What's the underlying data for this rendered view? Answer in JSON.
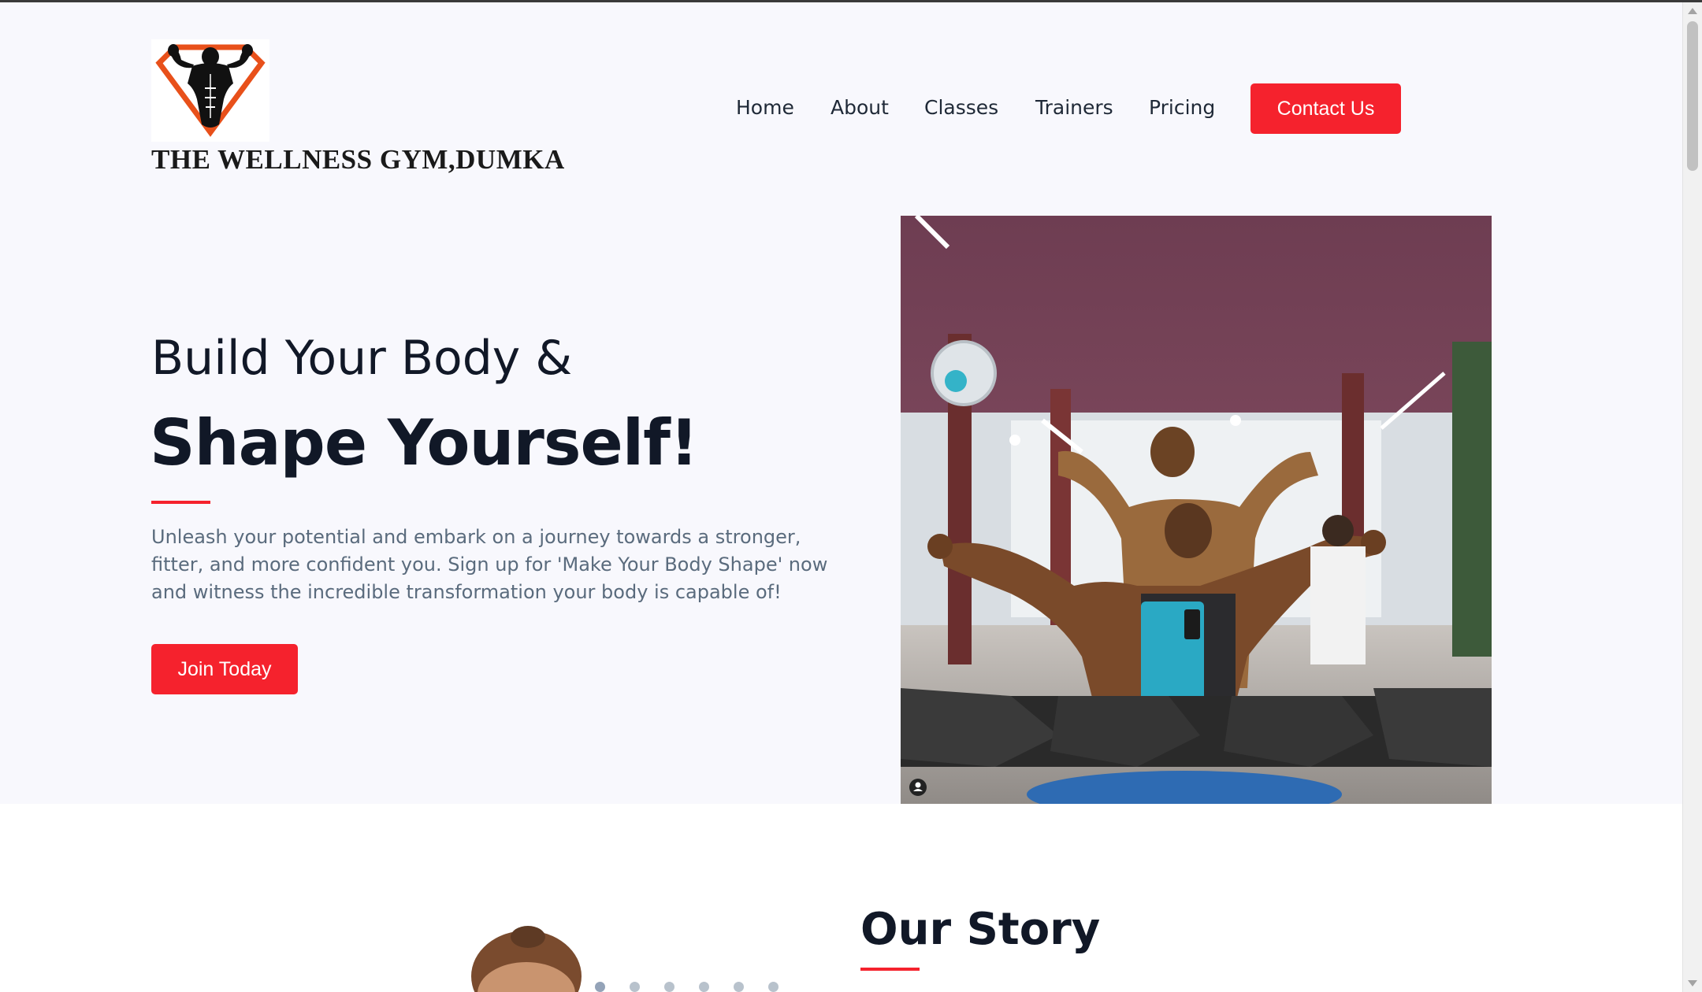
{
  "brand": {
    "name": "THE WELLNESS GYM,DUMKA",
    "logo_icon": "flexing-bodybuilder-icon",
    "logo_accent": "#e8501a"
  },
  "nav": {
    "items": [
      {
        "label": "Home"
      },
      {
        "label": "About"
      },
      {
        "label": "Classes"
      },
      {
        "label": "Trainers"
      },
      {
        "label": "Pricing"
      }
    ],
    "contact_label": "Contact Us"
  },
  "hero": {
    "line1": "Build Your Body &",
    "line2": "Shape Yourself!",
    "paragraph": "Unleash your potential and embark on a journey towards a stronger, fitter, and more confident you. Sign up for 'Make Your Body Shape' now and witness the incredible transformation your body is capable of!",
    "cta_label": "Join Today",
    "image": "gym-selfie-photo"
  },
  "story": {
    "title": "Our Story",
    "carousel_dot_count": 6
  },
  "colors": {
    "accent": "#f5222d",
    "heading": "#111827",
    "body_text": "#5a6b7d",
    "hero_bg": "#f8f8fd"
  }
}
